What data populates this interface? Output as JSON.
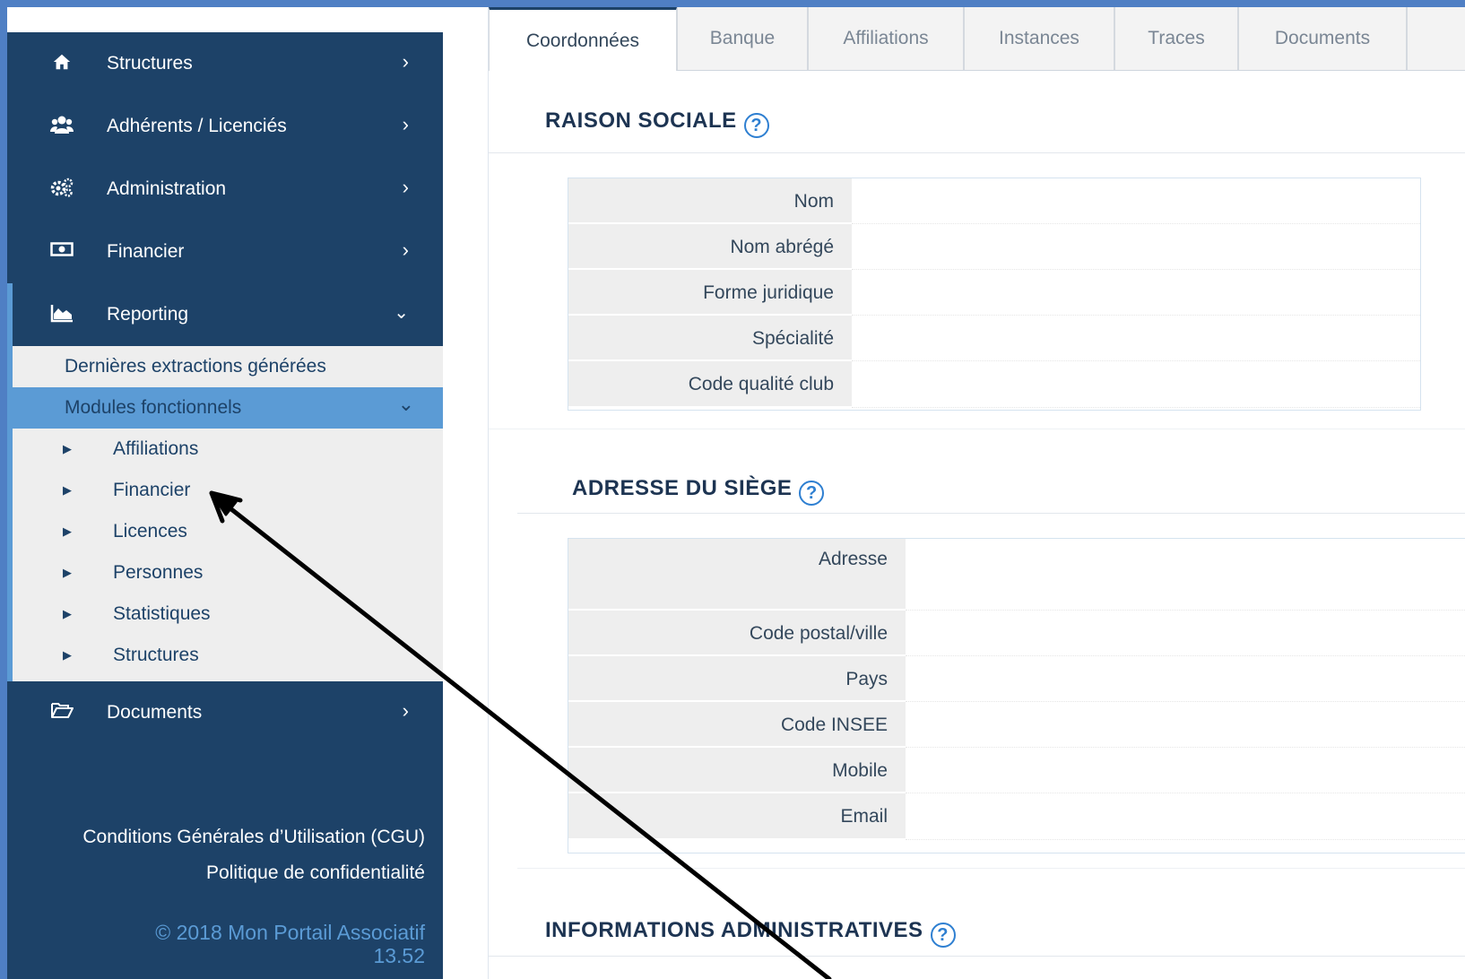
{
  "sidebar": {
    "main_items": [
      {
        "label": "Structures",
        "icon": "home-icon"
      },
      {
        "label": "Adhérents / Licenciés",
        "icon": "users-icon"
      },
      {
        "label": "Administration",
        "icon": "cogs-icon"
      },
      {
        "label": "Financier",
        "icon": "money-icon"
      },
      {
        "label": "Reporting",
        "icon": "area-chart-icon"
      }
    ],
    "reporting_sub": {
      "recent": "Dernières extractions générées",
      "modules": "Modules fonctionnels",
      "modules_items": [
        "Affiliations",
        "Financier",
        "Licences",
        "Personnes",
        "Statistiques",
        "Structures"
      ]
    },
    "documents": {
      "label": "Documents",
      "icon": "folder-open-icon"
    },
    "footer": {
      "cgu": "Conditions Générales d’Utilisation (CGU)",
      "privacy": "Politique de confidentialité",
      "copyright": "© 2018 Mon Portail Associatif",
      "version": "13.52"
    }
  },
  "tabs": [
    "Coordonnées",
    "Banque",
    "Affiliations",
    "Instances",
    "Traces",
    "Documents"
  ],
  "sections": {
    "raison_sociale": {
      "title": "RAISON SOCIALE",
      "fields": [
        "Nom",
        "Nom abrégé",
        "Forme juridique",
        "Spécialité",
        "Code qualité club"
      ]
    },
    "adresse": {
      "title": "ADRESSE DU SIÈGE",
      "fields": [
        "Adresse",
        "Code postal/ville",
        "Pays",
        "Code INSEE",
        "Mobile",
        "Email"
      ]
    },
    "infos_admin": {
      "title": "INFORMATIONS ADMINISTRATIVES"
    }
  },
  "help_glyph": "?",
  "colors": {
    "sidebar_bg": "#1d4268",
    "accent": "#5b9bd5",
    "frame": "#4f7fc4",
    "help": "#2e7fd1"
  }
}
